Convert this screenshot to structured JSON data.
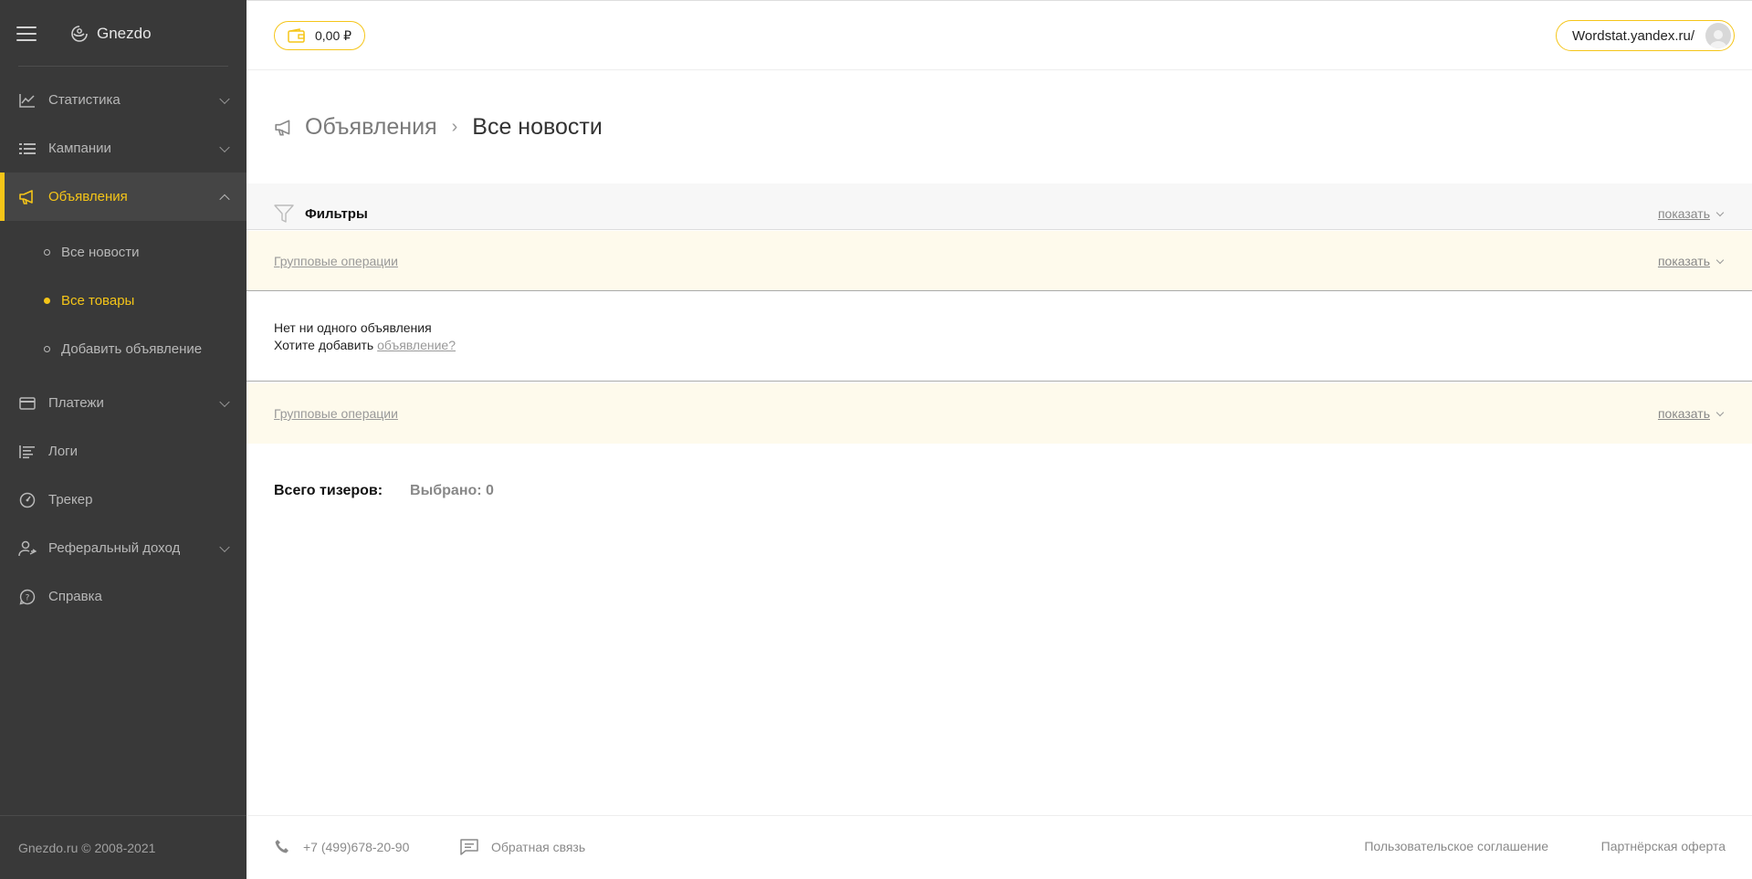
{
  "brand": {
    "name": "Gnezdo"
  },
  "header": {
    "balance": "0,00 ₽",
    "site": "Wordstat.yandex.ru/"
  },
  "sidebar": {
    "items": [
      {
        "label": "Статистика"
      },
      {
        "label": "Кампании"
      },
      {
        "label": "Объявления"
      },
      {
        "label": "Платежи"
      },
      {
        "label": "Логи"
      },
      {
        "label": "Трекер"
      },
      {
        "label": "Реферальный доход"
      },
      {
        "label": "Справка"
      }
    ],
    "subitems": [
      {
        "label": "Все новости"
      },
      {
        "label": "Все товары"
      },
      {
        "label": "Добавить объявление"
      }
    ],
    "copyright": "Gnezdo.ru © 2008-2021"
  },
  "breadcrumb": {
    "parent": "Объявления",
    "current": "Все новости"
  },
  "filters": {
    "title": "Фильтры",
    "show": "показать"
  },
  "group_ops": {
    "label": "Групповые операции",
    "show": "показать"
  },
  "empty": {
    "line1": "Нет ни одного объявления",
    "line2_prefix": "Хотите добавить ",
    "line2_link": "объявление?"
  },
  "totals": {
    "total_label": "Всего тизеров:",
    "selected_label": "Выбрано: 0"
  },
  "footer": {
    "phone": "+7 (499)678-20-90",
    "feedback": "Обратная связь",
    "agreement": "Пользовательское соглашение",
    "offer": "Партнёрская оферта"
  },
  "colors": {
    "accent": "#f5c518",
    "sidebar_bg": "#393939"
  }
}
